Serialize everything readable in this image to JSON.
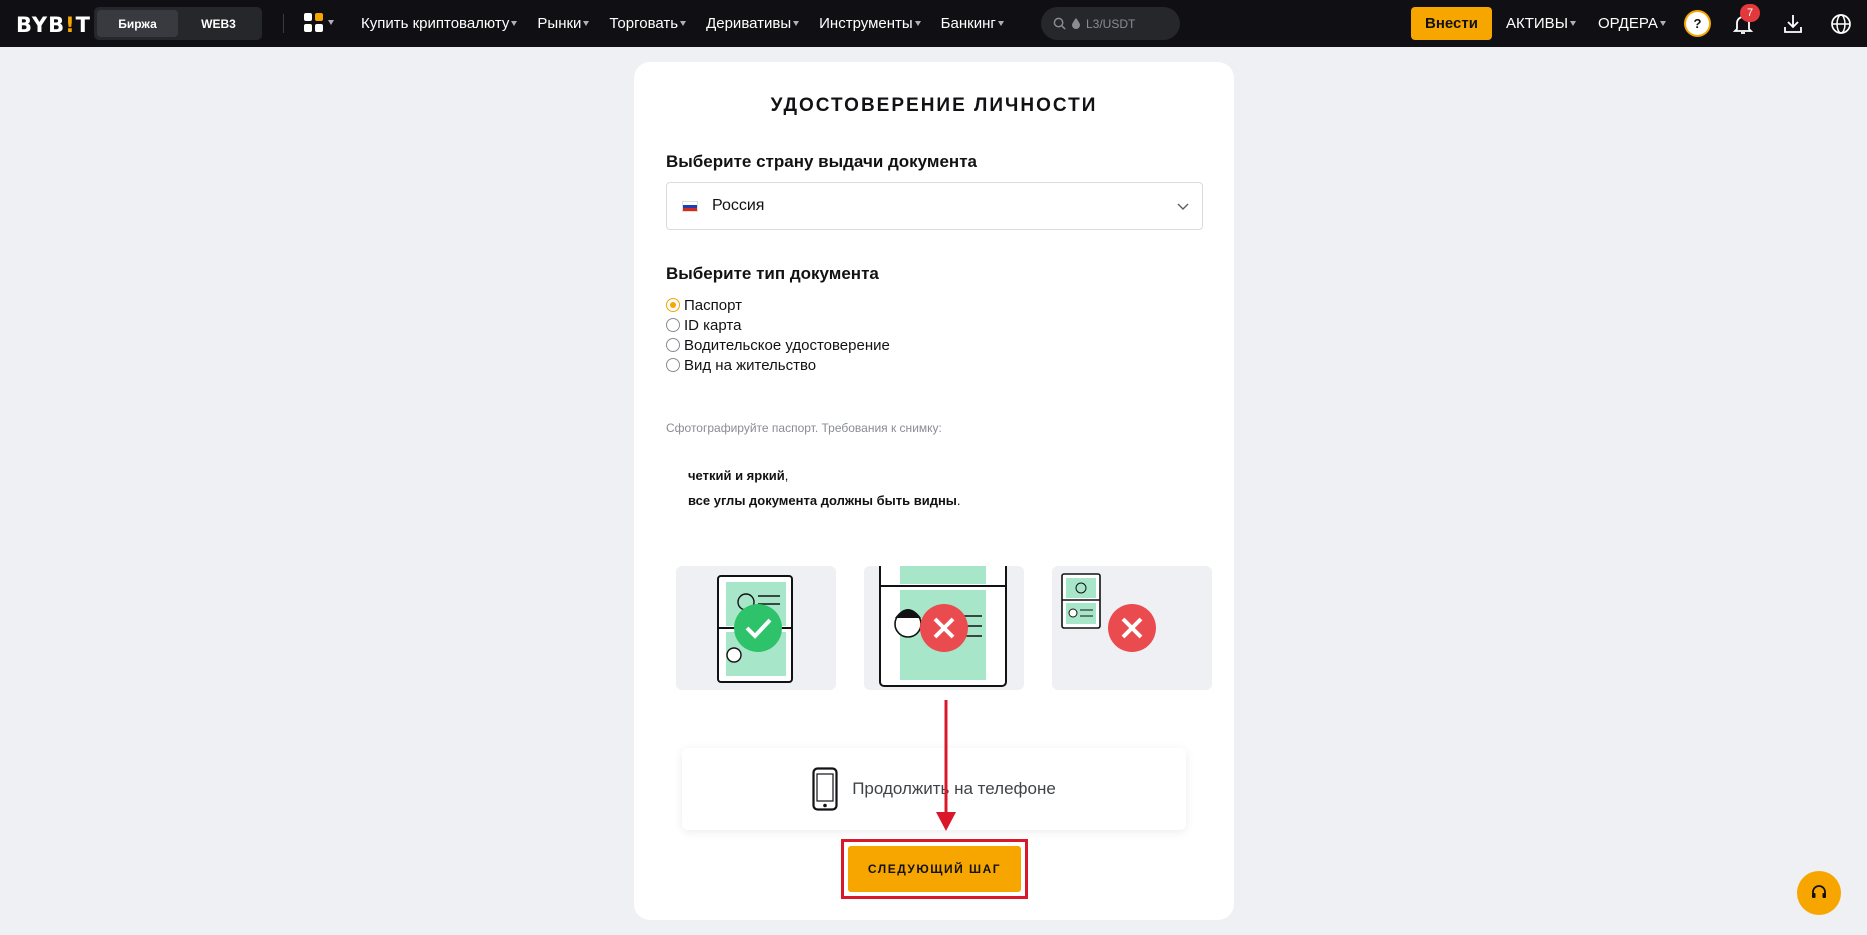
{
  "header": {
    "logo": "BYBIT",
    "segment": [
      "Биржа",
      "WEB3"
    ],
    "nav": [
      "Купить криптовалюту",
      "Рынки",
      "Торговать",
      "Деривативы",
      "Инструменты",
      "Банкинг"
    ],
    "search_placeholder": "L3/USDT",
    "deposit_label": "Внести",
    "assets_label": "АКТИВЫ",
    "orders_label": "ОРДЕРА",
    "notification_count": "7",
    "accent": "#f7a600"
  },
  "verification": {
    "title": "УДОСТОВЕРЕНИЕ ЛИЧНОСТИ",
    "country_label": "Выберите страну выдачи документа",
    "country_value": "Россия",
    "doc_type_label": "Выберите тип документа",
    "doc_types": [
      "Паспорт",
      "ID карта",
      "Водительское удостоверение",
      "Вид на жительство"
    ],
    "selected_doc_type": "Паспорт",
    "photo_hint": "Сфотографируйте паспорт. Требования к снимку:",
    "requirements": [
      {
        "text": "четкий и яркий",
        "punct": ","
      },
      {
        "text": "все углы документа должны быть видны",
        "punct": "."
      }
    ],
    "continue_on_phone": "Продолжить на телефоне",
    "next_button": "СЛЕДУЮЩИЙ ШАГ"
  }
}
